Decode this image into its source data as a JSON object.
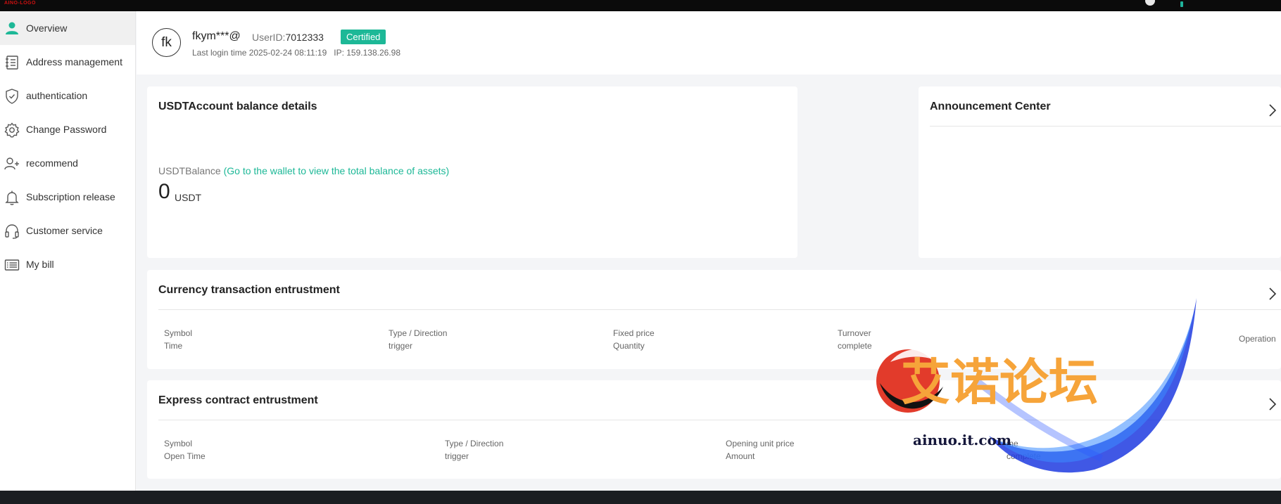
{
  "topbar": {
    "logo_text": "AINO-LOGO"
  },
  "sidebar": {
    "items": [
      {
        "label": "Overview",
        "icon": "user-icon",
        "active": true
      },
      {
        "label": "Address management",
        "icon": "address-book-icon"
      },
      {
        "label": "authentication",
        "icon": "shield-check-icon"
      },
      {
        "label": "Change Password",
        "icon": "gear-icon"
      },
      {
        "label": "recommend",
        "icon": "user-plus-icon"
      },
      {
        "label": "Subscription release",
        "icon": "bell-icon"
      },
      {
        "label": "Customer service",
        "icon": "headset-icon"
      },
      {
        "label": "My bill",
        "icon": "list-icon"
      }
    ]
  },
  "profile": {
    "avatar_initials": "fk",
    "username": "fkym***@",
    "userid_label": "UserID:",
    "userid_value": "7012333",
    "badge": "Certified",
    "last_login": "Last login time 2025-02-24 08:11:19   IP: 159.138.26.98"
  },
  "balance_card": {
    "title": "USDTAccount balance details",
    "balance_label": "USDTBalance",
    "wallet_link": "(Go to the wallet to view the total balance of assets)",
    "value": "0",
    "unit": "USDT"
  },
  "announcement": {
    "title": "Announcement Center"
  },
  "currency_card": {
    "title": "Currency transaction entrustment",
    "columns": [
      {
        "line1": "Symbol",
        "line2": "Time"
      },
      {
        "line1": "Type / Direction",
        "line2": "trigger"
      },
      {
        "line1": "Fixed price",
        "line2": "Quantity"
      },
      {
        "line1": "Turnover",
        "line2": "complete"
      }
    ],
    "operation": "Operation"
  },
  "contract_card": {
    "title": "Express contract entrustment",
    "columns": [
      {
        "line1": "Symbol",
        "line2": "Open Time"
      },
      {
        "line1": "Type / Direction",
        "line2": "trigger"
      },
      {
        "line1": "Opening unit price",
        "line2": "Amount"
      },
      {
        "line1": "me",
        "line2": "complete"
      }
    ]
  },
  "watermark": {
    "chinese_text": "艾诺论坛",
    "domain_text": "ainuo.it.com",
    "colors": {
      "orange": "#f6a43a",
      "red": "#e23b2b",
      "blue": "#1f3be0"
    }
  },
  "colors": {
    "accent": "#1db897",
    "topbar": "#0b0b0b"
  }
}
